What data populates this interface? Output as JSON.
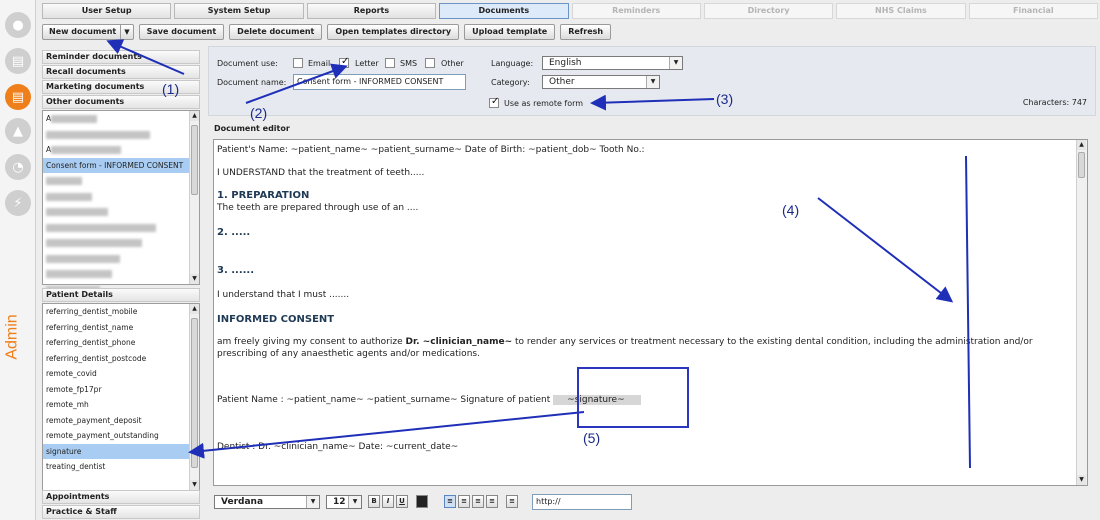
{
  "rail": {
    "admin_label": "Admin"
  },
  "tabs": [
    {
      "label": "User Setup",
      "state": "normal"
    },
    {
      "label": "System Setup",
      "state": "normal"
    },
    {
      "label": "Reports",
      "state": "normal"
    },
    {
      "label": "Documents",
      "state": "active"
    },
    {
      "label": "Reminders",
      "state": "disabled"
    },
    {
      "label": "Directory",
      "state": "disabled"
    },
    {
      "label": "NHS Claims",
      "state": "disabled"
    },
    {
      "label": "Financial",
      "state": "disabled"
    }
  ],
  "toolbar": {
    "new_document": "New document",
    "save_document": "Save document",
    "delete_document": "Delete document",
    "open_templates": "Open templates directory",
    "upload_template": "Upload template",
    "refresh": "Refresh"
  },
  "left_categories": {
    "reminder": "Reminder documents",
    "recall": "Recall documents",
    "marketing": "Marketing documents",
    "other": "Other documents"
  },
  "documents_list": {
    "items": [
      {
        "label": "A",
        "blur_width": 46
      },
      {
        "label": "",
        "blur_width": 104
      },
      {
        "label": "A",
        "blur_width": 70
      },
      {
        "label": "Consent form - INFORMED CONSENT",
        "blur_width": 0,
        "selected": true
      },
      {
        "label": "",
        "blur_width": 36
      },
      {
        "label": "",
        "blur_width": 46
      },
      {
        "label": "",
        "blur_width": 62
      },
      {
        "label": "",
        "blur_width": 110
      },
      {
        "label": "",
        "blur_width": 96
      },
      {
        "label": "",
        "blur_width": 74
      },
      {
        "label": "",
        "blur_width": 66
      },
      {
        "label": "",
        "blur_width": 54
      }
    ]
  },
  "patient_details": {
    "header": "Patient Details",
    "items": [
      "referring_dentist_mobile",
      "referring_dentist_name",
      "referring_dentist_phone",
      "referring_dentist_postcode",
      "remote_covid",
      "remote_fp17pr",
      "remote_mh",
      "remote_payment_deposit",
      "remote_payment_outstanding",
      "signature",
      "treating_dentist"
    ],
    "selected": "signature"
  },
  "bottom_categories": {
    "appointments": "Appointments",
    "practice": "Practice & Staff"
  },
  "settings": {
    "document_use_label": "Document use:",
    "email": "Email",
    "letter": "Letter",
    "sms": "SMS",
    "other": "Other",
    "document_name_label": "Document name:",
    "document_name_value": "Consent form - INFORMED CONSENT",
    "language_label": "Language:",
    "language_value": "English",
    "category_label": "Category:",
    "category_value": "Other",
    "remote_form_label": "Use as remote form",
    "characters": "Characters: 747"
  },
  "editor": {
    "title": "Document editor",
    "line1": "Patient's Name:  ~patient_name~ ~patient_surname~       Date of Birth:  ~patient_dob~   Tooth No.:",
    "line2": "I UNDERSTAND that the treatment of teeth.....",
    "h_prep": "1. PREPARATION",
    "line3": "The teeth are prepared through use of an ....",
    "h2": "2. .....",
    "h3": "3. ......",
    "line4": "I understand that I must .......",
    "h_informed": "INFORMED CONSENT",
    "consent_a": " am freely giving my consent to authorize ",
    "consent_dr": "Dr. ~clinician_name~",
    "consent_b": " to render any services or treatment necessary to the existing dental condition, including the administration and/or",
    "consent_c": "prescribing of any anaesthetic agents and/or medications.",
    "patient_line": "Patient  Name :    ~patient_name~ ~patient_surname~        Signature of patient",
    "signature_token": "~signature~",
    "dentist_line": "Dentist :   Dr. ~clinician_name~                  Date: ~current_date~"
  },
  "format_toolbar": {
    "font": "Verdana",
    "size": "12",
    "url_placeholder": "http://"
  },
  "annotations": [
    "(1)",
    "(2)",
    "(3)",
    "(4)",
    "(5)"
  ]
}
